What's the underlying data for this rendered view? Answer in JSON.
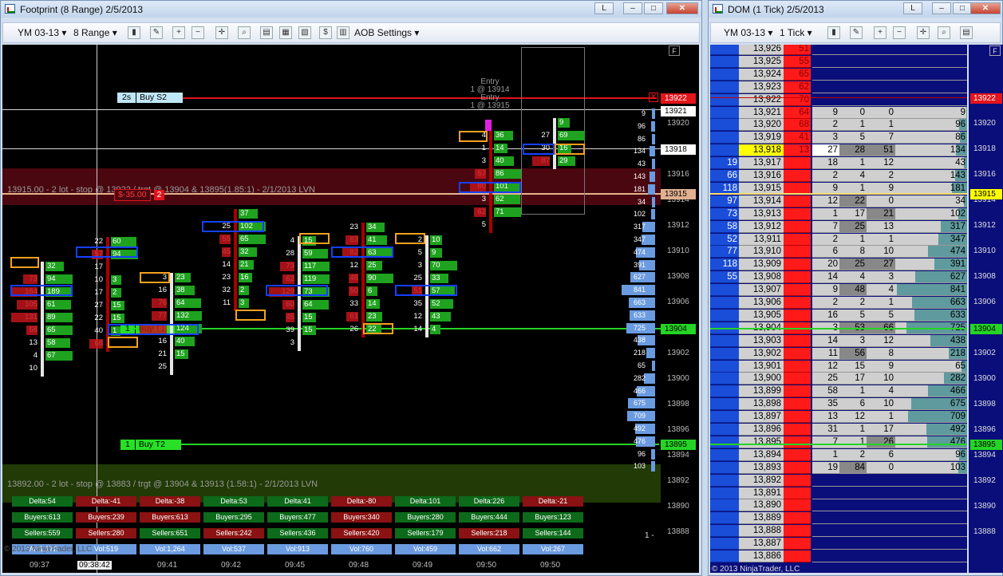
{
  "footprint": {
    "title": "Footprint (8 Range)  2/5/2013",
    "toolbar": {
      "instrument": "YM 03-13",
      "period": "8 Range",
      "aob": "AOB Settings"
    },
    "axis_flag": "F",
    "price_ticks": [
      "13920",
      "13918",
      "13916",
      "13914",
      "13912",
      "13910",
      "13908",
      "13906",
      "13904",
      "13902",
      "13900",
      "13898",
      "13896",
      "13894",
      "13892",
      "13890",
      "13888"
    ],
    "price_flags": [
      {
        "text": "13922",
        "color": "#e4141b"
      },
      {
        "text": "13921",
        "color": "#ffffff"
      },
      {
        "text": "13918",
        "color": "#ffffff"
      },
      {
        "text": "13915",
        "color": "#e0b090"
      },
      {
        "text": "13904",
        "color": "#25d425"
      },
      {
        "text": "13895",
        "color": "#25d425"
      }
    ],
    "time_ticks": [
      "09:37",
      "09:38:42",
      "09:41",
      "09:42",
      "09:45",
      "09:48",
      "09:49",
      "09:50",
      "09:50"
    ],
    "entry": {
      "line1": "Entry",
      "line2": "1 @ 13914",
      "line3": "Entry",
      "line4": "1 @ 13915"
    },
    "order_stop": {
      "qty": "2s",
      "label": "Buy S2"
    },
    "order_t1": {
      "qty": "1",
      "label": "Buy T1"
    },
    "order_t2": {
      "qty": "1",
      "label": "Buy T2"
    },
    "pnl": "$-35.00",
    "pnl_qty": "2",
    "zone1": "13915.00 - 2 lot - stop @ 13922 / trgt @ 13904 & 13895(1.85:1) - 2/1/2013 LVN",
    "zone2": "13892.00 - 2 lot - stop @ 13883 / trgt @ 13904 & 13913 (1.58:1) - 2/1/2013 LVN",
    "stats": {
      "delta": [
        "Delta:54",
        "Delta:-41",
        "Delta:-38",
        "Delta:53",
        "Delta:41",
        "Delta:-80",
        "Delta:101",
        "Delta:226",
        "Delta:-21"
      ],
      "buyers": [
        "Buyers:613",
        "Buyers:239",
        "Buyers:613",
        "Buyers:295",
        "Buyers:477",
        "Buyers:340",
        "Buyers:280",
        "Buyers:444",
        "Buyers:123"
      ],
      "sellers": [
        "Sellers:559",
        "Sellers:280",
        "Sellers:651",
        "Sellers:242",
        "Sellers:436",
        "Sellers:420",
        "Sellers:179",
        "Sellers:218",
        "Sellers:144"
      ],
      "vol": [
        "Vol:1,172",
        "Vol:519",
        "Vol:1,264",
        "Vol:537",
        "Vol:913",
        "Vol:760",
        "Vol:459",
        "Vol:662",
        "Vol:267"
      ]
    },
    "volume_profile": [
      "9",
      "96",
      "86",
      "134",
      "43",
      "143",
      "181",
      "34",
      "102",
      "317",
      "347",
      "474",
      "391",
      "627",
      "841",
      "663",
      "633",
      "725",
      "438",
      "218",
      "65",
      "282",
      "466",
      "675",
      "709",
      "492",
      "476",
      "96",
      "103"
    ],
    "one_label": "1 -",
    "copyright": "© 2013 NinjaTrader, LLC",
    "bars": [
      {
        "rows": [
          [
            "",
            "32"
          ],
          [
            "73",
            "94"
          ],
          [
            "164",
            "189"
          ],
          [
            "105",
            "61"
          ],
          [
            "131",
            "89"
          ],
          [
            "58",
            "65"
          ],
          [
            "13",
            "58"
          ],
          [
            "4",
            "67"
          ],
          [
            "10",
            ""
          ]
        ]
      },
      {
        "rows": [
          [
            "22",
            "60"
          ],
          [
            "57",
            "94"
          ],
          [
            "17",
            ""
          ],
          [
            "10",
            "3"
          ],
          [
            "17",
            "2"
          ],
          [
            "27",
            "15"
          ],
          [
            "22",
            "15"
          ],
          [
            "40",
            "1"
          ],
          [
            "68",
            ""
          ]
        ]
      },
      {
        "rows": [
          [
            "3",
            "23"
          ],
          [
            "16",
            "38"
          ],
          [
            "76",
            "64"
          ],
          [
            "77",
            "132"
          ],
          [
            "183",
            "124"
          ],
          [
            "16",
            "40"
          ],
          [
            "21",
            "15"
          ],
          [
            "25",
            ""
          ]
        ]
      },
      {
        "rows": [
          [
            "",
            "37"
          ],
          [
            "25",
            "102"
          ],
          [
            "55",
            "65"
          ],
          [
            "45",
            "32"
          ],
          [
            "14",
            "21"
          ],
          [
            "23",
            "16"
          ],
          [
            "32",
            "2"
          ],
          [
            "11",
            "3"
          ]
        ]
      },
      {
        "rows": [
          [
            "4",
            "15"
          ],
          [
            "28",
            "59"
          ],
          [
            "73",
            "117"
          ],
          [
            "62",
            "119"
          ],
          [
            "129",
            "73"
          ],
          [
            "60",
            "64"
          ],
          [
            "45",
            "15"
          ],
          [
            "39",
            "15"
          ],
          [
            "3",
            ""
          ]
        ]
      },
      {
        "rows": [
          [
            "23",
            "34"
          ],
          [
            "63",
            "41"
          ],
          [
            "82",
            "63"
          ],
          [
            "12",
            "25"
          ],
          [
            "48",
            "90"
          ],
          [
            "50",
            "6"
          ],
          [
            "33",
            "14"
          ],
          [
            "61",
            "23"
          ],
          [
            "26",
            "22"
          ]
        ]
      },
      {
        "rows": [
          [
            "2",
            "10"
          ],
          [
            "5",
            "9"
          ],
          [
            "3",
            "70"
          ],
          [
            "25",
            "33"
          ],
          [
            "51",
            "57"
          ],
          [
            "35",
            "52"
          ],
          [
            "12",
            "43"
          ],
          [
            "14",
            "4"
          ]
        ]
      },
      {
        "rows": [
          [
            "4",
            "36"
          ],
          [
            "1",
            "14"
          ],
          [
            "3",
            "40"
          ],
          [
            "57",
            "86"
          ],
          [
            "80",
            "101"
          ],
          [
            "3",
            "62"
          ],
          [
            "62",
            "71"
          ],
          [
            "5",
            ""
          ]
        ]
      },
      {
        "rows": [
          [
            "",
            "9"
          ],
          [
            "27",
            "69"
          ],
          [
            "30",
            "16"
          ],
          [
            "87",
            "29"
          ]
        ]
      }
    ]
  },
  "dom": {
    "title": "DOM (1 Tick)  2/5/2013",
    "toolbar": {
      "instrument": "YM 03-13",
      "period": "1 Tick"
    },
    "axis_flag": "F",
    "price_flags": [
      "13922",
      "13915",
      "13904",
      "13895"
    ],
    "copyright": "© 2013 NinjaTrader, LLC",
    "ticks": [
      "13920",
      "13918",
      "13916",
      "13914",
      "13912",
      "13910",
      "13908",
      "13906",
      "13904",
      "13902",
      "13900",
      "13898",
      "13896",
      "13894",
      "13892",
      "13890",
      "13888"
    ],
    "rows": [
      [
        "",
        "13,926",
        "51",
        "",
        "",
        "",
        ""
      ],
      [
        "",
        "13,925",
        "55",
        "",
        "",
        "",
        ""
      ],
      [
        "",
        "13,924",
        "65",
        "",
        "",
        "",
        ""
      ],
      [
        "",
        "13,923",
        "62",
        "",
        "",
        "",
        ""
      ],
      [
        "",
        "13,922",
        "70",
        "",
        "",
        "",
        ""
      ],
      [
        "",
        "13,921",
        "64",
        "9",
        "0",
        "0",
        "9"
      ],
      [
        "",
        "13,920",
        "68",
        "2",
        "1",
        "1",
        "96"
      ],
      [
        "",
        "13,919",
        "41",
        "3",
        "5",
        "7",
        "86"
      ],
      [
        "",
        "13,918",
        "13",
        "27",
        "28",
        "51",
        "134"
      ],
      [
        "19",
        "13,917",
        "",
        "18",
        "1",
        "12",
        "43"
      ],
      [
        "66",
        "13,916",
        "",
        "2",
        "4",
        "2",
        "143"
      ],
      [
        "118",
        "13,915",
        "",
        "9",
        "1",
        "9",
        "181"
      ],
      [
        "97",
        "13,914",
        "",
        "12",
        "22",
        "0",
        "34"
      ],
      [
        "73",
        "13,913",
        "",
        "1",
        "17",
        "21",
        "102"
      ],
      [
        "58",
        "13,912",
        "",
        "7",
        "25",
        "13",
        "317"
      ],
      [
        "52",
        "13,911",
        "",
        "2",
        "1",
        "1",
        "347"
      ],
      [
        "77",
        "13,910",
        "",
        "6",
        "8",
        "10",
        "474"
      ],
      [
        "118",
        "13,909",
        "",
        "20",
        "25",
        "27",
        "391"
      ],
      [
        "55",
        "13,908",
        "",
        "14",
        "4",
        "3",
        "627"
      ],
      [
        "",
        "13,907",
        "",
        "9",
        "48",
        "4",
        "841"
      ],
      [
        "",
        "13,906",
        "",
        "2",
        "2",
        "1",
        "663"
      ],
      [
        "",
        "13,905",
        "",
        "16",
        "5",
        "5",
        "633"
      ],
      [
        "",
        "13,904",
        "",
        "3",
        "53",
        "66",
        "725"
      ],
      [
        "",
        "13,903",
        "",
        "14",
        "3",
        "12",
        "438"
      ],
      [
        "",
        "13,902",
        "",
        "11",
        "56",
        "8",
        "218"
      ],
      [
        "",
        "13,901",
        "",
        "12",
        "15",
        "9",
        "65"
      ],
      [
        "",
        "13,900",
        "",
        "25",
        "17",
        "10",
        "282"
      ],
      [
        "",
        "13,899",
        "",
        "58",
        "1",
        "4",
        "466"
      ],
      [
        "",
        "13,898",
        "",
        "35",
        "6",
        "10",
        "675"
      ],
      [
        "",
        "13,897",
        "",
        "13",
        "12",
        "1",
        "709"
      ],
      [
        "",
        "13,896",
        "",
        "31",
        "1",
        "17",
        "492"
      ],
      [
        "",
        "13,895",
        "",
        "7",
        "1",
        "26",
        "476"
      ],
      [
        "",
        "13,894",
        "",
        "1",
        "2",
        "6",
        "96"
      ],
      [
        "",
        "13,893",
        "",
        "19",
        "84",
        "0",
        "103"
      ],
      [
        "",
        "13,892",
        "",
        "",
        "",
        "",
        ""
      ],
      [
        "",
        "13,891",
        "",
        "",
        "",
        "",
        ""
      ],
      [
        "",
        "13,890",
        "",
        "",
        "",
        "",
        ""
      ],
      [
        "",
        "13,889",
        "",
        "",
        "",
        "",
        ""
      ],
      [
        "",
        "13,888",
        "",
        "",
        "",
        "",
        ""
      ],
      [
        "",
        "13,887",
        "",
        "",
        "",
        "",
        ""
      ],
      [
        "",
        "13,886",
        "",
        "",
        "",
        "",
        ""
      ]
    ]
  }
}
